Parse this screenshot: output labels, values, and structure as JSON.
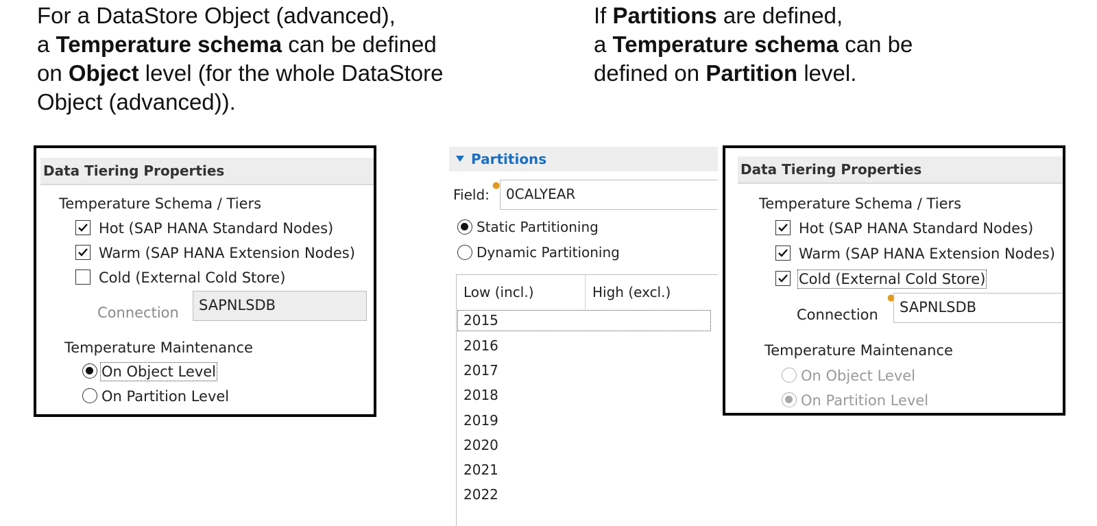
{
  "caption_left": {
    "line1": "For a DataStore Object (advanced),",
    "line2_pre": "a ",
    "line2_bold": "Temperature schema",
    "line2_post": " can be defined",
    "line3_pre": "on ",
    "line3_bold": "Object",
    "line3_post": " level (for the whole DataStore",
    "line4": "Object (advanced))."
  },
  "caption_right": {
    "line1_pre": "If ",
    "line1_bold": "Partitions",
    "line1_post": " are defined,",
    "line2_pre": "a ",
    "line2_bold": "Temperature schema",
    "line2_post": " can be",
    "line3_pre": "defined on ",
    "line3_bold": "Partition",
    "line3_post": " level."
  },
  "left_panel": {
    "title": "Data Tiering Properties",
    "tiers_label": "Temperature Schema / Tiers",
    "tiers": [
      {
        "label": "Hot (SAP HANA Standard Nodes)",
        "checked": true
      },
      {
        "label": "Warm (SAP HANA Extension Nodes)",
        "checked": true
      },
      {
        "label": "Cold (External Cold Store)",
        "checked": false
      }
    ],
    "connection_label": "Connection",
    "connection_value": "SAPNLSDB",
    "maintenance_label": "Temperature Maintenance",
    "maintenance_options": [
      {
        "label": "On Object Level",
        "selected": true
      },
      {
        "label": "On Partition Level",
        "selected": false
      }
    ]
  },
  "partitions": {
    "title": "Partitions",
    "field_label": "Field:",
    "field_value": "0CALYEAR",
    "options": [
      {
        "label": "Static Partitioning",
        "selected": true
      },
      {
        "label": "Dynamic Partitioning",
        "selected": false
      }
    ],
    "columns": [
      "Low (incl.)",
      "High (excl.)"
    ],
    "rows": [
      "2015",
      "2016",
      "2017",
      "2018",
      "2019",
      "2020",
      "2021",
      "2022"
    ]
  },
  "right_panel": {
    "title": "Data Tiering Properties",
    "tiers_label": "Temperature Schema / Tiers",
    "tiers": [
      {
        "label": "Hot (SAP HANA Standard Nodes)",
        "checked": true
      },
      {
        "label": "Warm (SAP HANA Extension Nodes)",
        "checked": true
      },
      {
        "label": "Cold (External Cold Store)",
        "checked": true
      }
    ],
    "connection_label": "Connection",
    "connection_value": "SAPNLSDB",
    "maintenance_label": "Temperature Maintenance",
    "maintenance_options": [
      {
        "label": "On Object Level",
        "selected": false
      },
      {
        "label": "On Partition Level",
        "selected": true
      }
    ]
  },
  "colors": {
    "accent_blue": "#1a6fc4",
    "header_gray": "#ededed",
    "marker_orange": "#e09a20"
  },
  "icons": {
    "checkmark": "checkmark-icon",
    "expand": "triangle-down-icon",
    "required_marker": "lightbulb-marker-icon"
  }
}
